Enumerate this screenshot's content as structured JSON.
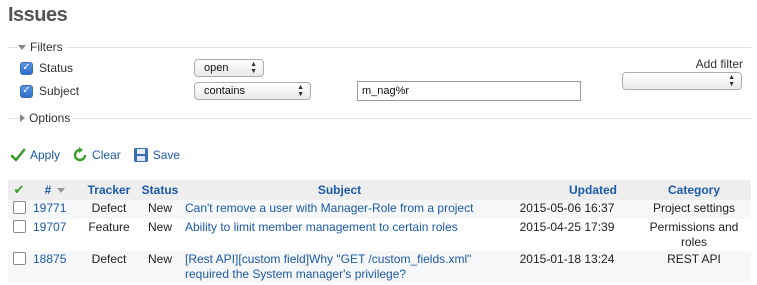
{
  "page": {
    "title": "Issues"
  },
  "filters": {
    "legend": "Filters",
    "add_filter_label": "Add filter",
    "add_filter_value": "",
    "rows": [
      {
        "label": "Status",
        "checked": true,
        "operator": "open",
        "value": ""
      },
      {
        "label": "Subject",
        "checked": true,
        "operator": "contains",
        "value": "m_nag%r"
      }
    ]
  },
  "options": {
    "legend": "Options"
  },
  "actions": {
    "apply": "Apply",
    "clear": "Clear",
    "save": "Save"
  },
  "table": {
    "headers": {
      "check": "✔",
      "id": "#",
      "tracker": "Tracker",
      "status": "Status",
      "subject": "Subject",
      "updated": "Updated",
      "category": "Category"
    },
    "rows": [
      {
        "id": "19771",
        "tracker": "Defect",
        "status": "New",
        "subject": "Can't remove a user with Manager-Role from a project",
        "updated": "2015-05-06 16:37",
        "category": "Project settings"
      },
      {
        "id": "19707",
        "tracker": "Feature",
        "status": "New",
        "subject": "Ability to limit member management to certain roles",
        "updated": "2015-04-25 17:39",
        "category": "Permissions and roles"
      },
      {
        "id": "18875",
        "tracker": "Defect",
        "status": "New",
        "subject": "[Rest API][custom field]Why \"GET /custom_fields.xml\" required the System manager's privilege?",
        "updated": "2015-01-18 13:24",
        "category": "REST API"
      }
    ]
  },
  "colors": {
    "link": "#1c5aa8",
    "header_bg": "#eeeeee",
    "apply_green": "#3a9b2a"
  }
}
